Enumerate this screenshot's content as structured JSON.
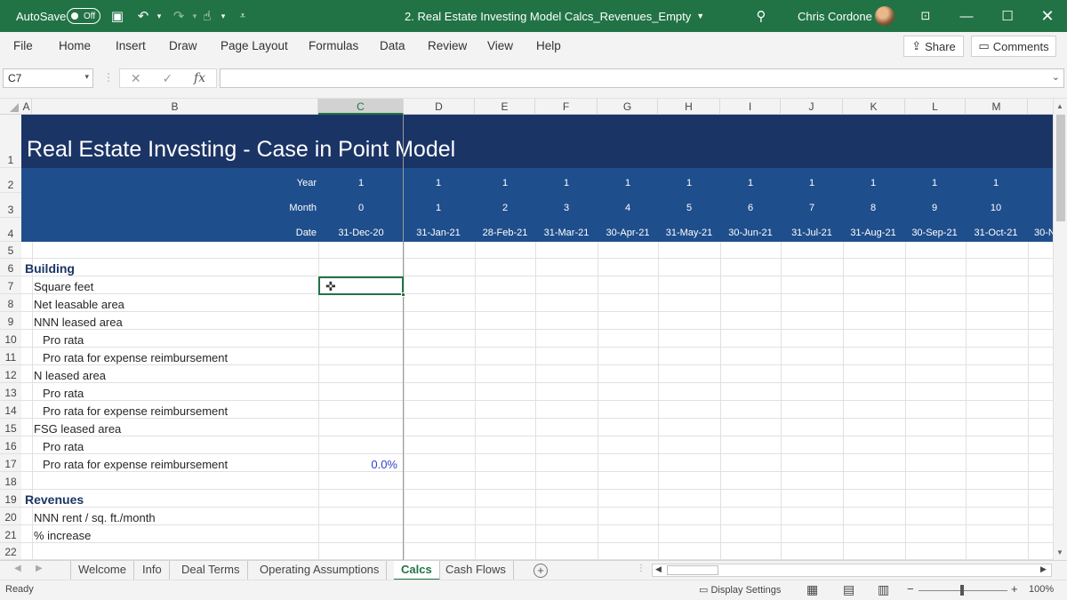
{
  "titlebar": {
    "autosave_label": "AutoSave",
    "autosave_state": "Off",
    "document_title": "2. Real Estate Investing Model Calcs_Revenues_Empty",
    "user_name": "Chris Cordone"
  },
  "ribbon": {
    "tabs": [
      "File",
      "Home",
      "Insert",
      "Draw",
      "Page Layout",
      "Formulas",
      "Data",
      "Review",
      "View",
      "Help"
    ],
    "share_label": "Share",
    "comments_label": "Comments"
  },
  "formula_bar": {
    "name_box": "C7",
    "fx_label": "fx",
    "formula": ""
  },
  "columns": [
    "A",
    "B",
    "C",
    "D",
    "E",
    "F",
    "G",
    "H",
    "I",
    "J",
    "K",
    "L",
    "M"
  ],
  "rows": [
    "1",
    "2",
    "3",
    "4",
    "5",
    "6",
    "7",
    "8",
    "9",
    "10",
    "11",
    "12",
    "13",
    "14",
    "15",
    "16",
    "17",
    "18",
    "19",
    "20",
    "21",
    "22"
  ],
  "sheet": {
    "title": "Real Estate Investing - Case in Point Model",
    "header_labels": {
      "year": "Year",
      "month": "Month",
      "date": "Date"
    },
    "years": [
      "1",
      "1",
      "1",
      "1",
      "1",
      "1",
      "1",
      "1",
      "1",
      "1",
      "1"
    ],
    "months": [
      "0",
      "1",
      "2",
      "3",
      "4",
      "5",
      "6",
      "7",
      "8",
      "9",
      "10"
    ],
    "dates": [
      "31-Dec-20",
      "31-Jan-21",
      "28-Feb-21",
      "31-Mar-21",
      "30-Apr-21",
      "31-May-21",
      "30-Jun-21",
      "31-Jul-21",
      "31-Aug-21",
      "30-Sep-21",
      "31-Oct-21",
      "30-N"
    ],
    "labels": {
      "r6": "Building",
      "r7": "Square feet",
      "r8": "Net leasable area",
      "r9": "NNN leased area",
      "r10": "Pro rata",
      "r11": "Pro rata for expense reimbursement",
      "r12": "N leased area",
      "r13": "Pro rata",
      "r14": "Pro rata for expense reimbursement",
      "r15": "FSG leased area",
      "r16": "Pro rata",
      "r17": "Pro rata for expense reimbursement",
      "r19": "Revenues",
      "r20": "NNN rent / sq. ft./month",
      "r21": "% increase"
    },
    "c17_value": "0.0%"
  },
  "sheet_tabs": [
    "Welcome",
    "Info",
    "Deal Terms",
    "Operating Assumptions",
    "Calcs",
    "Cash Flows"
  ],
  "active_sheet": "Calcs",
  "status": {
    "ready": "Ready",
    "display_settings": "Display Settings",
    "zoom": "100%"
  },
  "colors": {
    "excel_green": "#217346",
    "title_band": "#1b3466",
    "header_band": "#1f4e8c"
  }
}
